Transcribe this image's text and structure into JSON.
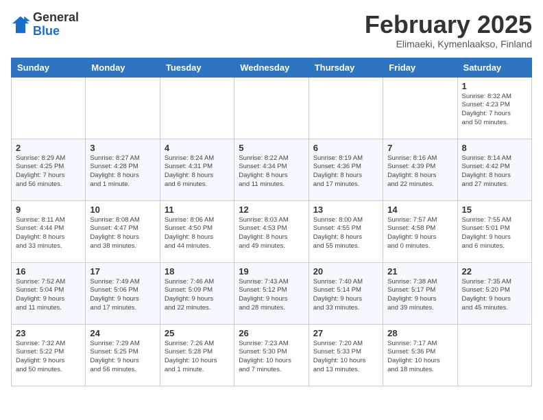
{
  "header": {
    "logo_general": "General",
    "logo_blue": "Blue",
    "title": "February 2025",
    "subtitle": "Elimaeki, Kymenlaakso, Finland"
  },
  "weekdays": [
    "Sunday",
    "Monday",
    "Tuesday",
    "Wednesday",
    "Thursday",
    "Friday",
    "Saturday"
  ],
  "weeks": [
    [
      {
        "day": "",
        "info": ""
      },
      {
        "day": "",
        "info": ""
      },
      {
        "day": "",
        "info": ""
      },
      {
        "day": "",
        "info": ""
      },
      {
        "day": "",
        "info": ""
      },
      {
        "day": "",
        "info": ""
      },
      {
        "day": "1",
        "info": "Sunrise: 8:32 AM\nSunset: 4:23 PM\nDaylight: 7 hours\nand 50 minutes."
      }
    ],
    [
      {
        "day": "2",
        "info": "Sunrise: 8:29 AM\nSunset: 4:25 PM\nDaylight: 7 hours\nand 56 minutes."
      },
      {
        "day": "3",
        "info": "Sunrise: 8:27 AM\nSunset: 4:28 PM\nDaylight: 8 hours\nand 1 minute."
      },
      {
        "day": "4",
        "info": "Sunrise: 8:24 AM\nSunset: 4:31 PM\nDaylight: 8 hours\nand 6 minutes."
      },
      {
        "day": "5",
        "info": "Sunrise: 8:22 AM\nSunset: 4:34 PM\nDaylight: 8 hours\nand 11 minutes."
      },
      {
        "day": "6",
        "info": "Sunrise: 8:19 AM\nSunset: 4:36 PM\nDaylight: 8 hours\nand 17 minutes."
      },
      {
        "day": "7",
        "info": "Sunrise: 8:16 AM\nSunset: 4:39 PM\nDaylight: 8 hours\nand 22 minutes."
      },
      {
        "day": "8",
        "info": "Sunrise: 8:14 AM\nSunset: 4:42 PM\nDaylight: 8 hours\nand 27 minutes."
      }
    ],
    [
      {
        "day": "9",
        "info": "Sunrise: 8:11 AM\nSunset: 4:44 PM\nDaylight: 8 hours\nand 33 minutes."
      },
      {
        "day": "10",
        "info": "Sunrise: 8:08 AM\nSunset: 4:47 PM\nDaylight: 8 hours\nand 38 minutes."
      },
      {
        "day": "11",
        "info": "Sunrise: 8:06 AM\nSunset: 4:50 PM\nDaylight: 8 hours\nand 44 minutes."
      },
      {
        "day": "12",
        "info": "Sunrise: 8:03 AM\nSunset: 4:53 PM\nDaylight: 8 hours\nand 49 minutes."
      },
      {
        "day": "13",
        "info": "Sunrise: 8:00 AM\nSunset: 4:55 PM\nDaylight: 8 hours\nand 55 minutes."
      },
      {
        "day": "14",
        "info": "Sunrise: 7:57 AM\nSunset: 4:58 PM\nDaylight: 9 hours\nand 0 minutes."
      },
      {
        "day": "15",
        "info": "Sunrise: 7:55 AM\nSunset: 5:01 PM\nDaylight: 9 hours\nand 6 minutes."
      }
    ],
    [
      {
        "day": "16",
        "info": "Sunrise: 7:52 AM\nSunset: 5:04 PM\nDaylight: 9 hours\nand 11 minutes."
      },
      {
        "day": "17",
        "info": "Sunrise: 7:49 AM\nSunset: 5:06 PM\nDaylight: 9 hours\nand 17 minutes."
      },
      {
        "day": "18",
        "info": "Sunrise: 7:46 AM\nSunset: 5:09 PM\nDaylight: 9 hours\nand 22 minutes."
      },
      {
        "day": "19",
        "info": "Sunrise: 7:43 AM\nSunset: 5:12 PM\nDaylight: 9 hours\nand 28 minutes."
      },
      {
        "day": "20",
        "info": "Sunrise: 7:40 AM\nSunset: 5:14 PM\nDaylight: 9 hours\nand 33 minutes."
      },
      {
        "day": "21",
        "info": "Sunrise: 7:38 AM\nSunset: 5:17 PM\nDaylight: 9 hours\nand 39 minutes."
      },
      {
        "day": "22",
        "info": "Sunrise: 7:35 AM\nSunset: 5:20 PM\nDaylight: 9 hours\nand 45 minutes."
      }
    ],
    [
      {
        "day": "23",
        "info": "Sunrise: 7:32 AM\nSunset: 5:22 PM\nDaylight: 9 hours\nand 50 minutes."
      },
      {
        "day": "24",
        "info": "Sunrise: 7:29 AM\nSunset: 5:25 PM\nDaylight: 9 hours\nand 56 minutes."
      },
      {
        "day": "25",
        "info": "Sunrise: 7:26 AM\nSunset: 5:28 PM\nDaylight: 10 hours\nand 1 minute."
      },
      {
        "day": "26",
        "info": "Sunrise: 7:23 AM\nSunset: 5:30 PM\nDaylight: 10 hours\nand 7 minutes."
      },
      {
        "day": "27",
        "info": "Sunrise: 7:20 AM\nSunset: 5:33 PM\nDaylight: 10 hours\nand 13 minutes."
      },
      {
        "day": "28",
        "info": "Sunrise: 7:17 AM\nSunset: 5:36 PM\nDaylight: 10 hours\nand 18 minutes."
      },
      {
        "day": "",
        "info": ""
      }
    ]
  ]
}
